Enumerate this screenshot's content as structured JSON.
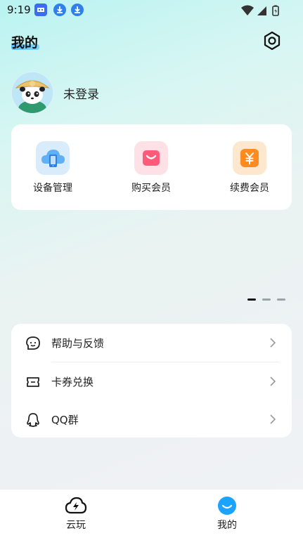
{
  "status_bar": {
    "time": "9:19"
  },
  "header": {
    "title": "我的"
  },
  "profile": {
    "name": "未登录"
  },
  "actions": [
    {
      "label": "设备管理",
      "icon": "device-cloud-icon"
    },
    {
      "label": "购买会员",
      "icon": "shopping-bag-icon"
    },
    {
      "label": "续费会员",
      "icon": "yen-icon"
    }
  ],
  "menu": [
    {
      "label": "帮助与反馈",
      "icon": "help-chat-icon"
    },
    {
      "label": "卡券兑换",
      "icon": "ticket-icon"
    },
    {
      "label": "QQ群",
      "icon": "qq-icon"
    }
  ],
  "bottom_nav": [
    {
      "label": "云玩",
      "icon": "cloud-play-icon",
      "selected": false
    },
    {
      "label": "我的",
      "icon": "smile-icon",
      "selected": true
    }
  ],
  "carousel": {
    "active_index": 0,
    "count": 3
  },
  "colors": {
    "accent": "#1aa3ff",
    "buy_icon": "#ff5a7a",
    "renew_icon": "#ff8a1f"
  }
}
